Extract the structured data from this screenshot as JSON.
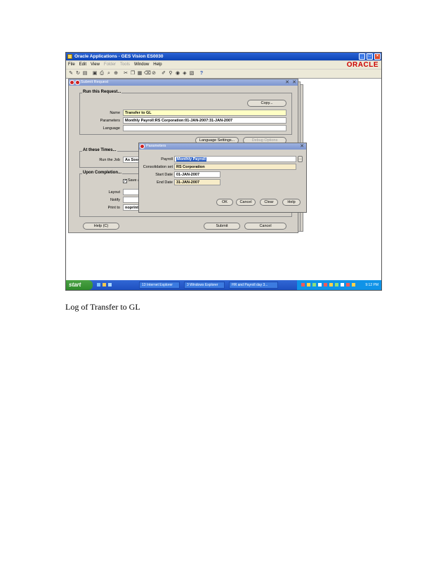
{
  "window": {
    "title": "Oracle Applications - GES Vision ES0030",
    "brand": "ORACLE",
    "menu": [
      "File",
      "Edit",
      "View",
      "Folder",
      "Tools",
      "Window",
      "Help"
    ]
  },
  "submit_request": {
    "title": "Submit Request",
    "run_section": "Run this Request...",
    "copy_button": "Copy...",
    "name_label": "Name",
    "name_value": "Transfer to GL",
    "parameters_label": "Parameters",
    "parameters_value": "Monthly Payroll:RS Corporation:01-JAN-2007:31-JAN-2007",
    "language_label": "Language",
    "language_settings_button": "Language Settings...",
    "debug_options_button": "Debug Options",
    "times_section": "At these Times...",
    "run_job_label": "Run the Job",
    "run_job_value": "As Soon",
    "completion_section": "Upon Completion...",
    "save_checkbox": "Save a",
    "layout_label": "Layout",
    "notify_label": "Notify",
    "print_to_label": "Print to",
    "print_to_value": "noprint",
    "help_button": "Help (C)",
    "submit_button": "Submit",
    "cancel_button": "Cancel"
  },
  "parameters": {
    "title": "Parameters",
    "payroll_label": "Payroll",
    "payroll_value": "Monthly Payroll",
    "consolidation_label": "Consolidation set",
    "consolidation_value": "RS Corporation",
    "start_date_label": "Start Date",
    "start_date_value": "01-JAN-2007",
    "end_date_label": "End Date",
    "end_date_value": "31-JAN-2007",
    "ok_button": "OK",
    "cancel_button": "Cancel",
    "clear_button": "Clear",
    "help_button": "Help"
  },
  "taskbar": {
    "start": "start",
    "tasks": [
      "13 Internet Explorer",
      "3 Windows Explorer",
      "HR and Payroll day 3..."
    ],
    "clock": "9:12 PM"
  },
  "caption": "Log of Transfer to GL"
}
